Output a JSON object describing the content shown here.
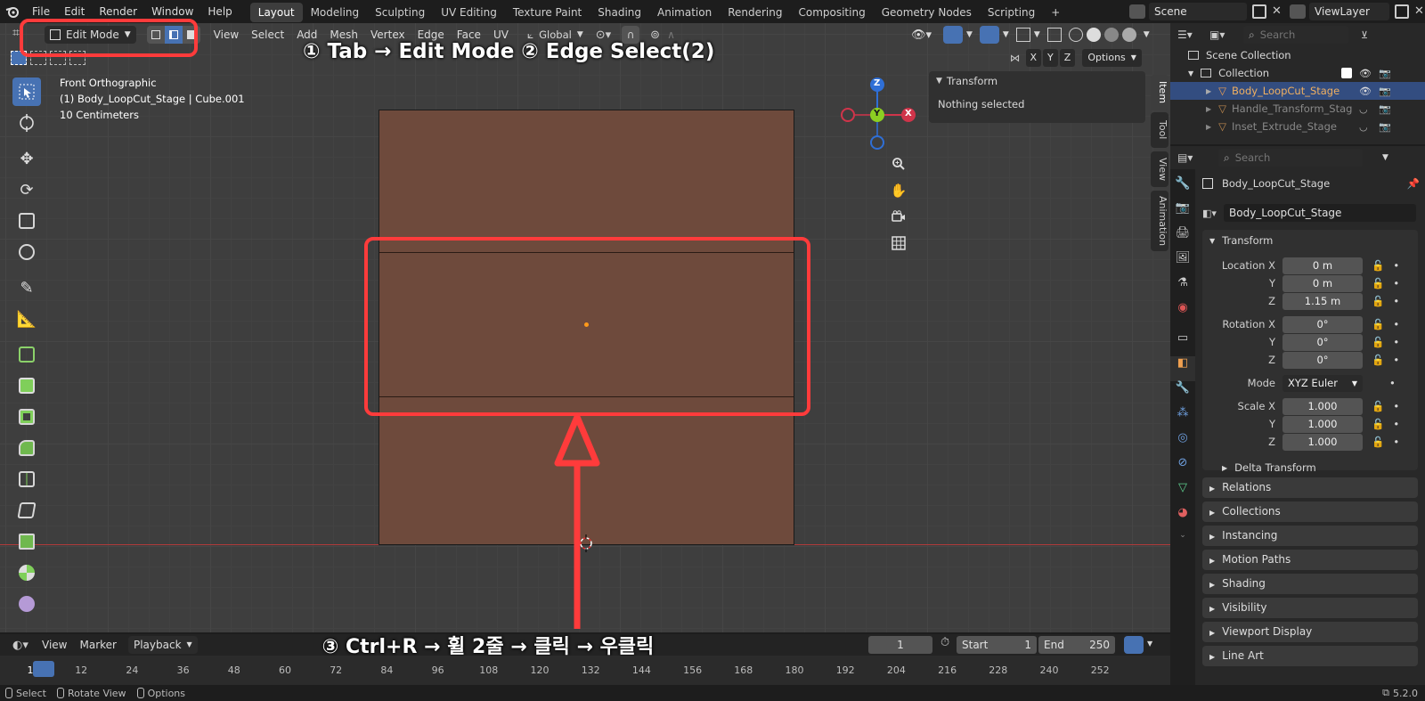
{
  "topbar": {
    "menus": [
      "File",
      "Edit",
      "Render",
      "Window",
      "Help"
    ],
    "workspaces": [
      "Layout",
      "Modeling",
      "Sculpting",
      "UV Editing",
      "Texture Paint",
      "Shading",
      "Animation",
      "Rendering",
      "Compositing",
      "Geometry Nodes",
      "Scripting"
    ],
    "active_workspace": "Layout",
    "plus": "+",
    "scene": "Scene",
    "view_layer": "ViewLayer"
  },
  "viewport_header": {
    "mode": "Edit Mode",
    "menus": [
      "View",
      "Select",
      "Add",
      "Mesh",
      "Vertex",
      "Edge",
      "Face",
      "UV"
    ],
    "transform_orientation": "Global",
    "options": "Options",
    "axes": [
      "X",
      "Y",
      "Z"
    ]
  },
  "viewport": {
    "view_name": "Front Orthographic",
    "object_info": "(1) Body_LoopCut_Stage | Cube.001",
    "scale": "10 Centimeters",
    "annotation_top": "① Tab → Edit Mode  ② Edge Select(2)",
    "annotation_bottom": "③ Ctrl+R → 휠 2줄 → 클릭 → 우클릭",
    "colors": {
      "mesh": "#6e4a3c",
      "annotation": "#ff3b3b",
      "active_blue": "#4772b3"
    }
  },
  "n_panel": {
    "header": "Transform",
    "message": "Nothing selected",
    "tabs": [
      "Item",
      "Tool",
      "View",
      "Animation"
    ]
  },
  "gizmo": {
    "z": "Z",
    "y": "Y",
    "x": "X"
  },
  "outliner": {
    "search_placeholder": "Search",
    "scene_collection": "Scene Collection",
    "collection": "Collection",
    "objects": [
      "Body_LoopCut_Stage",
      "Handle_Transform_Stag",
      "Inset_Extrude_Stage"
    ]
  },
  "properties": {
    "search_placeholder": "Search",
    "object_name": "Body_LoopCut_Stage",
    "datablock": "Body_LoopCut_Stage",
    "transform_header": "Transform",
    "location": {
      "label": "Location X",
      "x": "0 m",
      "y_label": "Y",
      "y": "0 m",
      "z_label": "Z",
      "z": "1.15 m"
    },
    "rotation": {
      "label": "Rotation X",
      "x": "0°",
      "y_label": "Y",
      "y": "0°",
      "z_label": "Z",
      "z": "0°"
    },
    "mode_label": "Mode",
    "mode": "XYZ Euler",
    "scale": {
      "label": "Scale X",
      "x": "1.000",
      "y_label": "Y",
      "y": "1.000",
      "z_label": "Z",
      "z": "1.000"
    },
    "delta": "Delta Transform",
    "panels": [
      "Relations",
      "Collections",
      "Instancing",
      "Motion Paths",
      "Shading",
      "Visibility",
      "Viewport Display",
      "Line Art"
    ]
  },
  "timeline": {
    "menus": [
      "View",
      "Marker",
      "Playback"
    ],
    "current_frame": "1",
    "start_label": "Start",
    "start": "1",
    "end_label": "End",
    "end": "250",
    "ticks": [
      "1",
      "12",
      "24",
      "36",
      "48",
      "60",
      "72",
      "84",
      "96",
      "108",
      "120",
      "132",
      "144",
      "156",
      "168",
      "180",
      "192",
      "204",
      "216",
      "228",
      "240",
      "252"
    ]
  },
  "statusbar": {
    "select": "Select",
    "rotate": "Rotate View",
    "options": "Options",
    "version": "5.2.0"
  }
}
